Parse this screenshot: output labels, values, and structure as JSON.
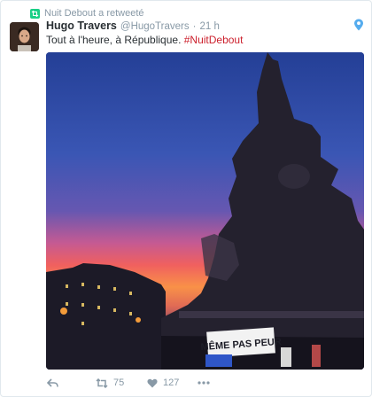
{
  "retweet_context": {
    "icon": "retweet-badge-icon",
    "text": "Nuit Debout a retweeté"
  },
  "tweet": {
    "fullname": "Hugo Travers",
    "handle": "@HugoTravers",
    "separator": "·",
    "time": "21 h",
    "text_before": "Tout à l'heure, à République. ",
    "hashtag": "#NuitDebout",
    "geo_icon": "location-pin-icon",
    "photo_banner_text": "MÊME PAS PEUR"
  },
  "actions": {
    "reply_icon": "reply-icon",
    "retweet_icon": "retweet-icon",
    "retweet_count": "75",
    "like_icon": "heart-icon",
    "like_count": "127",
    "more_icon": "more-icon"
  },
  "colors": {
    "hashtag": "#cc1f2c",
    "muted": "#8899a6",
    "retweet_green": "#19cf86",
    "geo_blue": "#55acee"
  }
}
